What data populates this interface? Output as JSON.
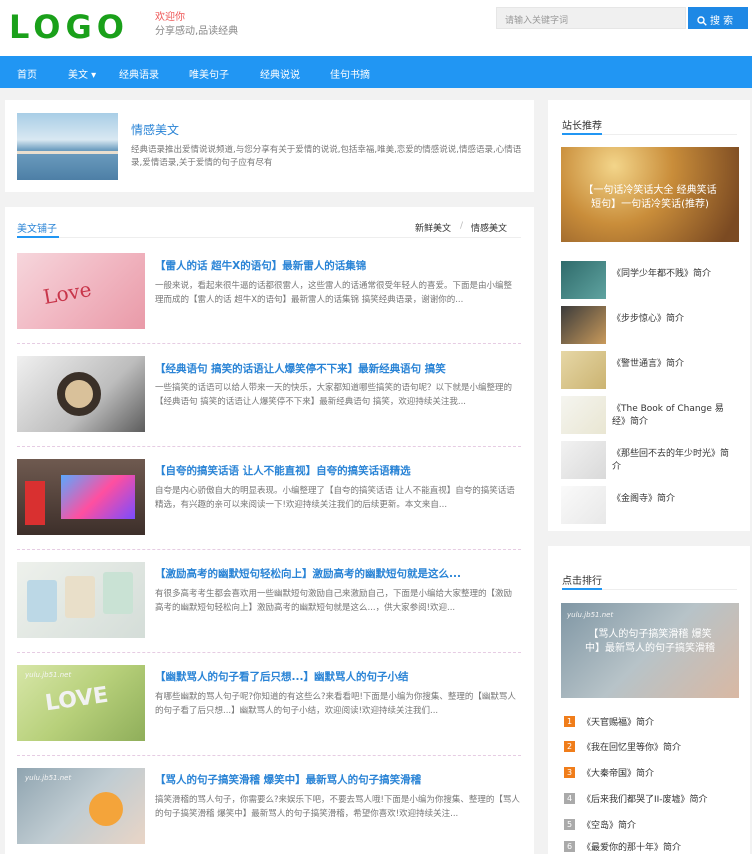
{
  "header": {
    "logo": "LOGO",
    "welcome": "欢迎你",
    "slogan": "分享感动,品读经典",
    "search_placeholder": "请输入关键字词",
    "search_button": "搜 索"
  },
  "nav": {
    "items": [
      "首页",
      "美文 ▾",
      "经典语录",
      "唯美句子",
      "经典说说",
      "佳句书摘"
    ]
  },
  "intro": {
    "title": "情感美文",
    "text": "经典语录推出爱情说说频道,与您分享有关于爱情的说说,包括幸福,唯美,恋爱的情感说说,情感语录,心情语录,爱情语录,关于爱情的句子应有尽有"
  },
  "articles_section": {
    "tab": "美文铺子",
    "sub_tabs": [
      "新鲜美文",
      "/",
      "情感美文"
    ]
  },
  "articles": [
    {
      "title": "【雷人的话 超牛X的语句】最新雷人的话集锦",
      "text": "一般来说，看起来很牛逼的话都很雷人，这些雷人的话通常很受年轻人的喜爱。下面是由小编整理而成的【雷人的话 超牛X的语句】最新雷人的话集锦 搞笑经典语录，谢谢你的..."
    },
    {
      "title": "【经典语句 搞笑的话语让人爆笑停不下来】最新经典语句 搞笑",
      "text": "一些搞笑的话语可以给人带来一天的快乐，大家都知道哪些搞笑的语句呢？以下就是小编整理的【经典语句 搞笑的话语让人爆笑停不下来】最新经典语句 搞笑，欢迎持续关注我..."
    },
    {
      "title": "【自夸的搞笑话语 让人不能直视】自夸的搞笑话语精选",
      "text": "自夸是内心骄傲自大的明显表现。小编整理了【自夸的搞笑话语 让人不能直视】自夸的搞笑话语精选，有兴趣的亲可以来阅读一下!欢迎持续关注我们的后续更新。本文来自..."
    },
    {
      "title": "【激励高考的幽默短句轻松向上】激励高考的幽默短句就是这么...",
      "text": "有很多高考考生都会喜欢用一些幽默短句激励自己来激励自己，下面是小编给大家整理的【激励高考的幽默短句轻松向上】激励高考的幽默短句就是这么...，供大家参阅!欢迎..."
    },
    {
      "title": "【幽默骂人的句子看了后只想...】幽默骂人的句子小结",
      "text": "有哪些幽默的骂人句子呢?你知道的有这些么?来看看吧!下面是小编为你搜集、整理的【幽默骂人的句子看了后只想...】幽默骂人的句子小结，欢迎阅读!欢迎持续关注我们..."
    },
    {
      "title": "【骂人的句子搞笑滑稽 爆笑中】最新骂人的句子搞笑滑稽",
      "text": "搞笑滑稽的骂人句子，你需要么?来娱乐下吧，不要去骂人哦!下面是小编为你搜集、整理的【骂人的句子搞笑滑稽 爆笑中】最新骂人的句子搞笑滑稽，希望你喜欢!欢迎持续关注..."
    }
  ],
  "sidebar": {
    "recommend_title": "站长推荐",
    "banner1": "【一句话冷笑话大全 经典笑话短句】一句话冷笑话(推荐)",
    "rec_items": [
      "《同学少年都不贱》简介",
      "《步步惊心》简介",
      "《警世通言》简介",
      "《The Book of Change 易经》简介",
      "《那些回不去的年少时光》简介",
      "《金阁寺》简介"
    ],
    "rank_title": "点击排行",
    "banner2": "【骂人的句子搞笑滑稽 爆笑中】最新骂人的句子搞笑滑稽",
    "watermark": "yulu.jb51.net",
    "rank_items": [
      {
        "num": "1",
        "text": "《天官赐福》简介"
      },
      {
        "num": "2",
        "text": "《我在回忆里等你》简介"
      },
      {
        "num": "3",
        "text": "《大秦帝国》简介"
      },
      {
        "num": "4",
        "text": "《后来我们都哭了II-废墟》简介"
      },
      {
        "num": "5",
        "text": "《空岛》简介"
      },
      {
        "num": "6",
        "text": "《最爱你的那十年》简介"
      }
    ]
  },
  "colors": {
    "primary": "#2196f3",
    "logo": "#1aa01a",
    "rank_hot": "#f07d1a",
    "rank_normal": "#aaaaaa"
  }
}
